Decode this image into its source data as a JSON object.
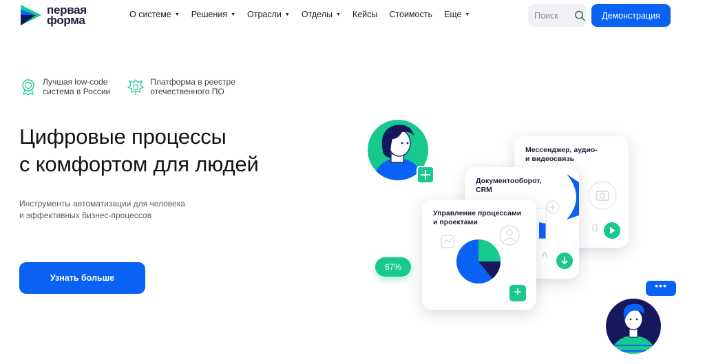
{
  "header": {
    "logo_line1": "первая",
    "logo_line2": "форма",
    "nav": [
      {
        "label": "О системе",
        "dropdown": true
      },
      {
        "label": "Решения",
        "dropdown": true
      },
      {
        "label": "Отрасли",
        "dropdown": true
      },
      {
        "label": "Отделы",
        "dropdown": true
      },
      {
        "label": "Кейсы",
        "dropdown": false
      },
      {
        "label": "Стоимость",
        "dropdown": false
      },
      {
        "label": "Еще",
        "dropdown": true
      }
    ],
    "search_placeholder": "Поиск",
    "demo_label": "Демонстрация"
  },
  "badges": [
    {
      "line1": "Лучшая low-code",
      "line2": "система в России",
      "icon": "award-medal-icon"
    },
    {
      "line1": "Платформа в реестре",
      "line2": "отечественного ПО",
      "icon": "coat-of-arms-icon"
    }
  ],
  "hero": {
    "title_line1": "Цифровые процессы",
    "title_line2": "с комфортом для людей",
    "subtitle_line1": "Инструменты автоматизации для человека",
    "subtitle_line2": "и эффективных бизнес-процессов",
    "cta_label": "Узнать больше"
  },
  "cards": {
    "messenger_title_line1": "Мессенджер, аудио-",
    "messenger_title_line2": "и видеосвязь",
    "docs_title_line1": "Документооборот,",
    "docs_title_line2": "CRM",
    "process_title_line1": "Управление процессами",
    "process_title_line2": "и проектами",
    "percent": "67%",
    "chat_dots": "•••"
  },
  "colors": {
    "brand_blue": "#0a62f5",
    "accent_green": "#17c98d",
    "dark_navy": "#16185e"
  }
}
